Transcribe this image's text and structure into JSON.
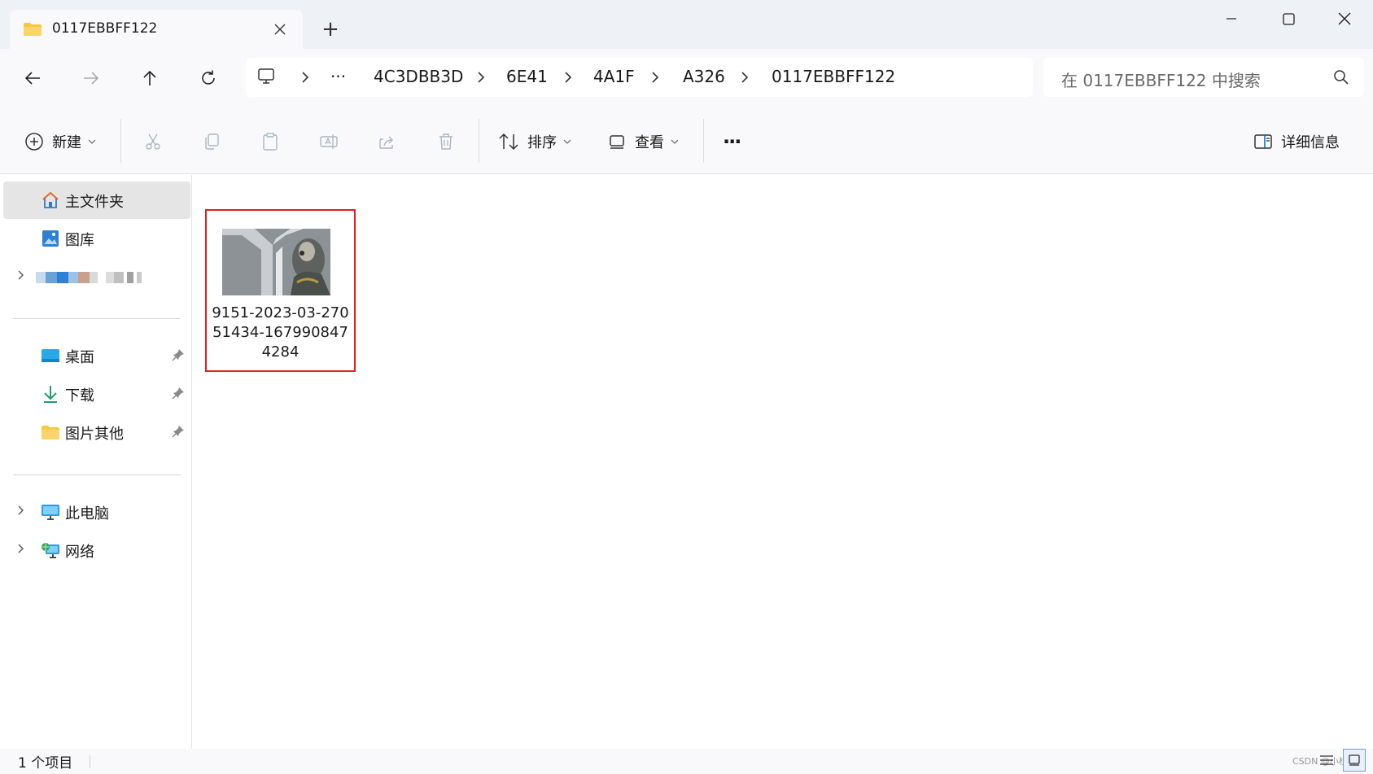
{
  "window": {
    "tab_title": "0117EBBFF122",
    "new_tab_label": "+"
  },
  "address": {
    "overflow_label": "···",
    "crumbs": [
      "4C3DBB3D",
      "6E41",
      "4A1F",
      "A326",
      "0117EBBFF122"
    ]
  },
  "search": {
    "placeholder": "在 0117EBBFF122 中搜索"
  },
  "toolbar": {
    "new_label": "新建",
    "sort_label": "排序",
    "view_label": "查看",
    "more_label": "···",
    "details_label": "详细信息"
  },
  "sidebar": {
    "items": [
      {
        "label": "主文件夹",
        "icon": "home-icon"
      },
      {
        "label": "图库",
        "icon": "gallery-icon"
      },
      {
        "label": "桌面",
        "icon": "desktop-icon"
      },
      {
        "label": "下载",
        "icon": "download-icon"
      },
      {
        "label": "图片其他",
        "icon": "folder-icon"
      },
      {
        "label": "此电脑",
        "icon": "computer-icon"
      },
      {
        "label": "网络",
        "icon": "network-icon"
      }
    ]
  },
  "files": [
    {
      "name": "9151-2023-03-27051434-1679908474284"
    }
  ],
  "status": {
    "item_count": "1 个项目",
    "watermark": "CSDN @小杜"
  },
  "colors": {
    "accent": "#0067c0",
    "selection_border": "#e02020",
    "folder": "#f8c640"
  }
}
